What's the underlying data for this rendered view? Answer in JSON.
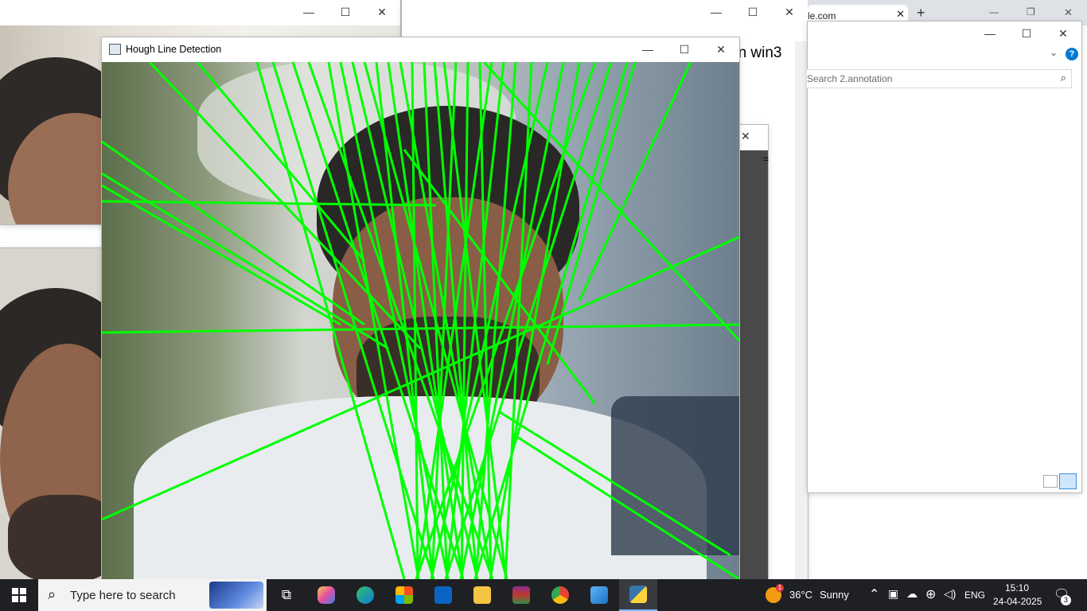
{
  "back_window_1": {
    "caption_buttons": [
      "minimize-icon",
      "maximize-icon",
      "close-icon"
    ]
  },
  "back_window_2": {
    "partial_title": "on win3"
  },
  "small_dialog": {
    "close_glyph": "✕",
    "partial_char": "="
  },
  "file_explorer": {
    "tab_partial": "le.com",
    "search_placeholder": "Search 2.annotation",
    "help_glyph": "?"
  },
  "hough_window": {
    "title": "Hough Line Detection",
    "line_color": "#00ff00"
  },
  "taskbar": {
    "search_placeholder": "Type here to search",
    "weather_temp": "36°C",
    "weather_desc": "Sunny",
    "language": "ENG",
    "time": "15:10",
    "date": "24-04-2025",
    "notification_count": "3",
    "weather_badge": "1"
  },
  "colors": {
    "taskbar_bg": "#1f2024",
    "accent_blue": "#0078d4",
    "hough_green": "#00ff00"
  }
}
